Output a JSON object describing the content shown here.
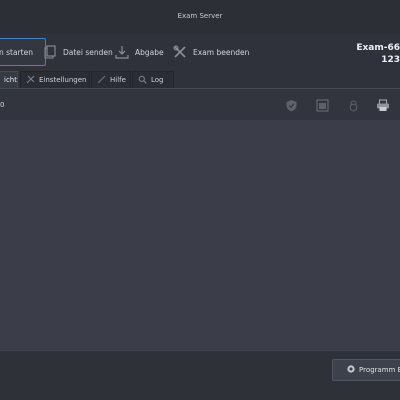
{
  "window": {
    "title": "Exam Server"
  },
  "toolbar": {
    "start_label": "n starten",
    "send_file_label": "Datei senden",
    "submit_label": "Abgabe",
    "end_exam_label": "Exam beenden"
  },
  "exam": {
    "id_line1": "Exam-66",
    "id_line2": "123"
  },
  "tabs": [
    {
      "label": "icht"
    },
    {
      "label": "Einstellungen"
    },
    {
      "label": "Hilfe"
    },
    {
      "label": "Log"
    }
  ],
  "panel": {
    "status_text": "0"
  },
  "footer": {
    "exit_label": "Programm Be"
  },
  "colors": {
    "accent": "#4a80c8",
    "background": "#3b3e48"
  }
}
